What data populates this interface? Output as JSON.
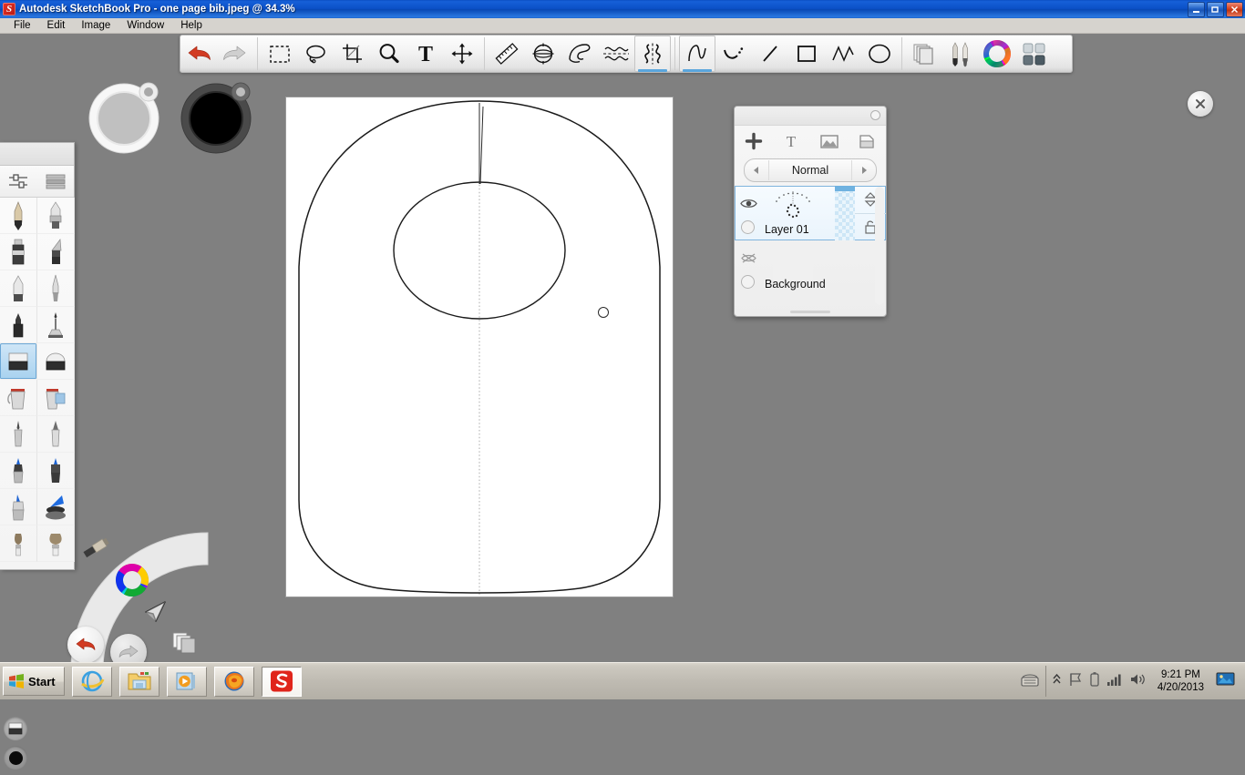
{
  "window": {
    "title": "Autodesk SketchBook Pro - one page bib.jpeg @ 34.3%",
    "app_icon": "S",
    "minimize_label": "_",
    "restore_label": "❐",
    "close_label": "✕"
  },
  "menubar": {
    "items": [
      {
        "label": "File"
      },
      {
        "label": "Edit"
      },
      {
        "label": "Image"
      },
      {
        "label": "Window"
      },
      {
        "label": "Help"
      }
    ]
  },
  "toolbar": {
    "groups": [
      {
        "name": "history",
        "buttons": [
          {
            "name": "undo-icon",
            "label": "Undo",
            "active": false
          },
          {
            "name": "redo-icon",
            "label": "Redo",
            "active": false
          }
        ]
      },
      {
        "name": "selection",
        "buttons": [
          {
            "name": "rectangle-select-icon",
            "label": "Rectangle Select",
            "active": false
          },
          {
            "name": "lasso-select-icon",
            "label": "Lasso Select",
            "active": false
          },
          {
            "name": "crop-icon",
            "label": "Crop",
            "active": false
          },
          {
            "name": "zoom-icon",
            "label": "Zoom",
            "active": false
          },
          {
            "name": "text-icon",
            "label": "Text",
            "active": false
          },
          {
            "name": "move-icon",
            "label": "Move",
            "active": false
          }
        ]
      },
      {
        "name": "guides",
        "buttons": [
          {
            "name": "ruler-icon",
            "label": "Ruler",
            "active": false
          },
          {
            "name": "ellipse-guide-icon",
            "label": "Ellipse Guide",
            "active": false
          },
          {
            "name": "french-curve-icon",
            "label": "French Curve",
            "active": false
          },
          {
            "name": "symmetry-horizontal-icon",
            "label": "Horizontal Symmetry",
            "active": false
          },
          {
            "name": "symmetry-vertical-icon",
            "label": "Vertical Symmetry",
            "active": true
          }
        ]
      },
      {
        "name": "shapes",
        "buttons": [
          {
            "name": "freehand-icon",
            "label": "Freehand",
            "active": true
          },
          {
            "name": "curve-icon",
            "label": "Curve",
            "active": false
          },
          {
            "name": "line-icon",
            "label": "Line",
            "active": false
          },
          {
            "name": "rectangle-icon",
            "label": "Rectangle",
            "active": false
          },
          {
            "name": "polyline-icon",
            "label": "Polyline",
            "active": false
          },
          {
            "name": "oval-icon",
            "label": "Oval",
            "active": false
          }
        ]
      },
      {
        "name": "panels",
        "buttons": [
          {
            "name": "layers-icon",
            "label": "Layers",
            "active": false
          },
          {
            "name": "brushes-icon",
            "label": "Brush Palette",
            "active": false
          },
          {
            "name": "color-wheel-icon",
            "label": "Color Wheel",
            "active": false
          },
          {
            "name": "tool-palette-icon",
            "label": "Tool Palette",
            "active": false
          }
        ]
      }
    ]
  },
  "pucks": [
    {
      "name": "brush-size-puck",
      "label": "Brush Size"
    },
    {
      "name": "brush-color-puck",
      "label": "Brush Color"
    }
  ],
  "brush_palette": {
    "header_tools": [
      {
        "name": "brush-properties-icon",
        "label": "Brush Properties"
      },
      {
        "name": "brush-list-view-icon",
        "label": "List View"
      }
    ],
    "brushes": [
      {
        "name": "pencil-brush",
        "label": "Pencil",
        "selected": false
      },
      {
        "name": "chisel-marker-brush",
        "label": "Chisel Marker",
        "selected": false
      },
      {
        "name": "marker-brush",
        "label": "Marker",
        "selected": false
      },
      {
        "name": "flat-brush",
        "label": "Flat Brush",
        "selected": false
      },
      {
        "name": "soft-marker-brush",
        "label": "Soft Marker",
        "selected": false
      },
      {
        "name": "airbrush-brush",
        "label": "Airbrush",
        "selected": false
      },
      {
        "name": "felt-pen-brush",
        "label": "Felt Pen",
        "selected": false
      },
      {
        "name": "spray-brush",
        "label": "Spray",
        "selected": false
      },
      {
        "name": "eraser-tool",
        "label": "Eraser",
        "selected": true
      },
      {
        "name": "soft-eraser-tool",
        "label": "Soft Eraser",
        "selected": false
      },
      {
        "name": "paint-bucket-tool",
        "label": "Fill",
        "selected": false
      },
      {
        "name": "paint-bucket-layer-tool",
        "label": "Fill Layer",
        "selected": false
      },
      {
        "name": "fine-pen-brush",
        "label": "Fine Pen",
        "selected": false
      },
      {
        "name": "sharp-pen-brush",
        "label": "Sharp Pen",
        "selected": false
      },
      {
        "name": "blue-marker-brush",
        "label": "Blue Marker",
        "selected": false
      },
      {
        "name": "blue-felt-brush",
        "label": "Blue Felt",
        "selected": false
      },
      {
        "name": "blue-highlighter-brush",
        "label": "Blue Highlighter",
        "selected": false
      },
      {
        "name": "blue-wedge-brush",
        "label": "Blue Wedge",
        "selected": false
      },
      {
        "name": "bristle-brush",
        "label": "Bristle Brush",
        "selected": false
      },
      {
        "name": "round-bristle-brush",
        "label": "Round Bristle",
        "selected": false
      }
    ],
    "footer": [
      {
        "name": "current-brush-swatch",
        "label": "Current Brush"
      },
      {
        "name": "current-color-swatch",
        "label": "Current Color",
        "color": "#0a0a0a"
      }
    ]
  },
  "lagoon": {
    "items": [
      {
        "name": "lagoon-brush-icon",
        "label": "Brush"
      },
      {
        "name": "lagoon-color-icon",
        "label": "Color"
      },
      {
        "name": "lagoon-cursor-icon",
        "label": "Cursor"
      },
      {
        "name": "lagoon-layers-icon",
        "label": "Layers"
      }
    ],
    "buttons": [
      {
        "name": "lagoon-undo-button",
        "label": "Undo"
      },
      {
        "name": "lagoon-redo-button",
        "label": "Redo"
      }
    ]
  },
  "layers_panel": {
    "tools": [
      {
        "name": "add-layer-icon",
        "label": "Add Layer"
      },
      {
        "name": "add-text-layer-icon",
        "label": "Add Text"
      },
      {
        "name": "add-image-layer-icon",
        "label": "Import Image"
      },
      {
        "name": "duplicate-layer-icon",
        "label": "Duplicate Layer"
      }
    ],
    "blend_mode": {
      "value": "Normal",
      "prev_label": "◀",
      "next_label": "▶"
    },
    "layers": [
      {
        "name": "Layer 01",
        "visible": true,
        "selected": true,
        "locked": false
      },
      {
        "name": "Background",
        "visible": false,
        "selected": false,
        "locked": false
      }
    ]
  },
  "canvas": {
    "close_label": "✕",
    "drawing_name": "bib-outline-drawing",
    "cursor_name": "brush-cursor"
  },
  "taskbar": {
    "start_label": "Start",
    "tasks": [
      {
        "name": "taskbar-internet-explorer",
        "label": "Internet Explorer",
        "active": false
      },
      {
        "name": "taskbar-file-explorer",
        "label": "Windows Explorer",
        "active": false
      },
      {
        "name": "taskbar-media-player",
        "label": "Windows Media Player",
        "active": false
      },
      {
        "name": "taskbar-firefox",
        "label": "Mozilla Firefox",
        "active": false
      },
      {
        "name": "taskbar-sketchbook",
        "label": "Autodesk SketchBook Pro",
        "active": true
      }
    ],
    "tray": {
      "icons": [
        {
          "name": "keyboard-icon",
          "label": "Tablet Input"
        },
        {
          "name": "show-hidden-icons-icon",
          "label": "Show hidden icons"
        },
        {
          "name": "flag-action-center-icon",
          "label": "Action Center"
        },
        {
          "name": "battery-icon",
          "label": "Battery"
        },
        {
          "name": "network-signal-icon",
          "label": "Network"
        },
        {
          "name": "volume-icon",
          "label": "Volume"
        }
      ],
      "time": "9:21 PM",
      "date": "4/20/2013",
      "show_desktop_name": "show-desktop-icon"
    }
  }
}
